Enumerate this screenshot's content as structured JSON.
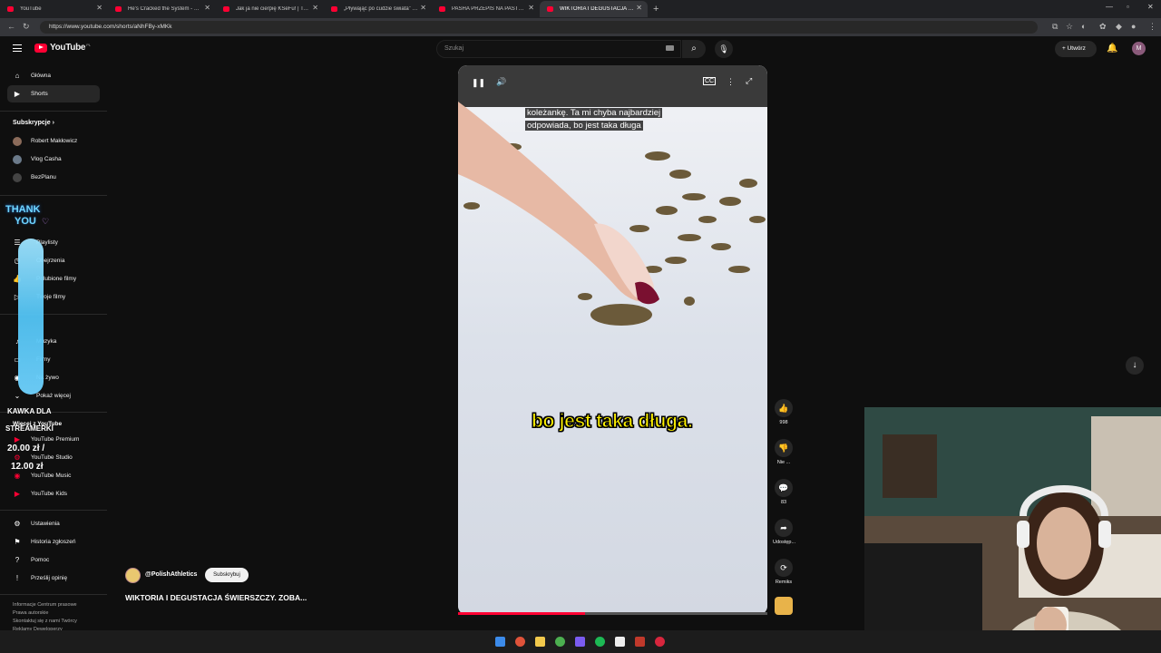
{
  "browser": {
    "tabs": [
      {
        "title": "YouTube",
        "active": false
      },
      {
        "title": "He's Cracked the System - YouTube",
        "active": false
      },
      {
        "title": "Jak ja nie cierpię KSeFu! | Tech Wi...",
        "active": false
      },
      {
        "title": "„Pływając po cudzie świata” - ROB...",
        "active": false
      },
      {
        "title": "PASHA PRZEPIS NA PASTĘ Z MAŁ...",
        "active": false
      },
      {
        "title": "WIKTORIA I DEGUSTACJA ŚW...",
        "active": true
      }
    ],
    "url": "https://www.youtube.com/shorts/aNhFBy-xMKk"
  },
  "header": {
    "logo_text": "YouTube",
    "logo_country": "PL",
    "search_placeholder": "Szukaj",
    "create_label": "Utwórz",
    "avatar_letter": "M"
  },
  "sidebar": {
    "main": [
      {
        "label": "Główna",
        "icon": "home-icon",
        "active": false
      },
      {
        "label": "Shorts",
        "icon": "shorts-icon",
        "active": true
      }
    ],
    "subs_header": "Subskrypcje",
    "subscriptions": [
      {
        "label": "Robert Makłowicz",
        "color": "#8b6b5a"
      },
      {
        "label": "Vlog Casha",
        "color": "#6b7a8a"
      },
      {
        "label": "BezPlanu",
        "color": "#444444"
      }
    ],
    "you_items": [
      "Playlisty",
      "Obejrzenia",
      "Polubione filmy",
      "Twoje filmy"
    ],
    "explore_items": [
      "Muzyka",
      "Filmy",
      "Na żywo"
    ],
    "show_more": "Pokaż więcej",
    "more_header": "Więcej z YouTube",
    "more_items": [
      "YouTube Premium",
      "YouTube Studio",
      "YouTube Music",
      "YouTube Kids"
    ],
    "settings_items": [
      "Ustawienia",
      "Historia zgłoszeń",
      "Pomoc",
      "Prześlij opinię"
    ],
    "footer": [
      "Informacje  Centrum prasowe",
      "Prawa autorskie",
      "Skontaktuj się z nami  Twórcy",
      "Reklamy  Deweloperzy"
    ]
  },
  "overlay": {
    "thank_line1": "THANK",
    "thank_line2": "YOU",
    "donation_line1": "KAWKA DLA",
    "donation_line2": "STREAMERKI",
    "price1": "20.00 zł /",
    "price2": "12.00 zł",
    "bar_color": "#52c4f5"
  },
  "player": {
    "subtitle_line1": "koleżankę. Ta mi chyba najbardziej",
    "subtitle_line2": "odpowiada, bo jest taka długa",
    "caption": "bo jest taka długa.",
    "progress": 0.41
  },
  "actions": {
    "likes": "998",
    "dislike": "Nie ...",
    "comments": "83",
    "share": "Udostęp...",
    "remix": "Remiks"
  },
  "channel": {
    "handle": "@PolishAthletics",
    "subscribe_label": "Subskrybuj",
    "video_title": "WIKTORIA I DEGUSTACJA ŚWIERSZCZY. ZOBA..."
  },
  "colors": {
    "brand_red": "#ff0033",
    "caption_yellow": "#fff200"
  }
}
